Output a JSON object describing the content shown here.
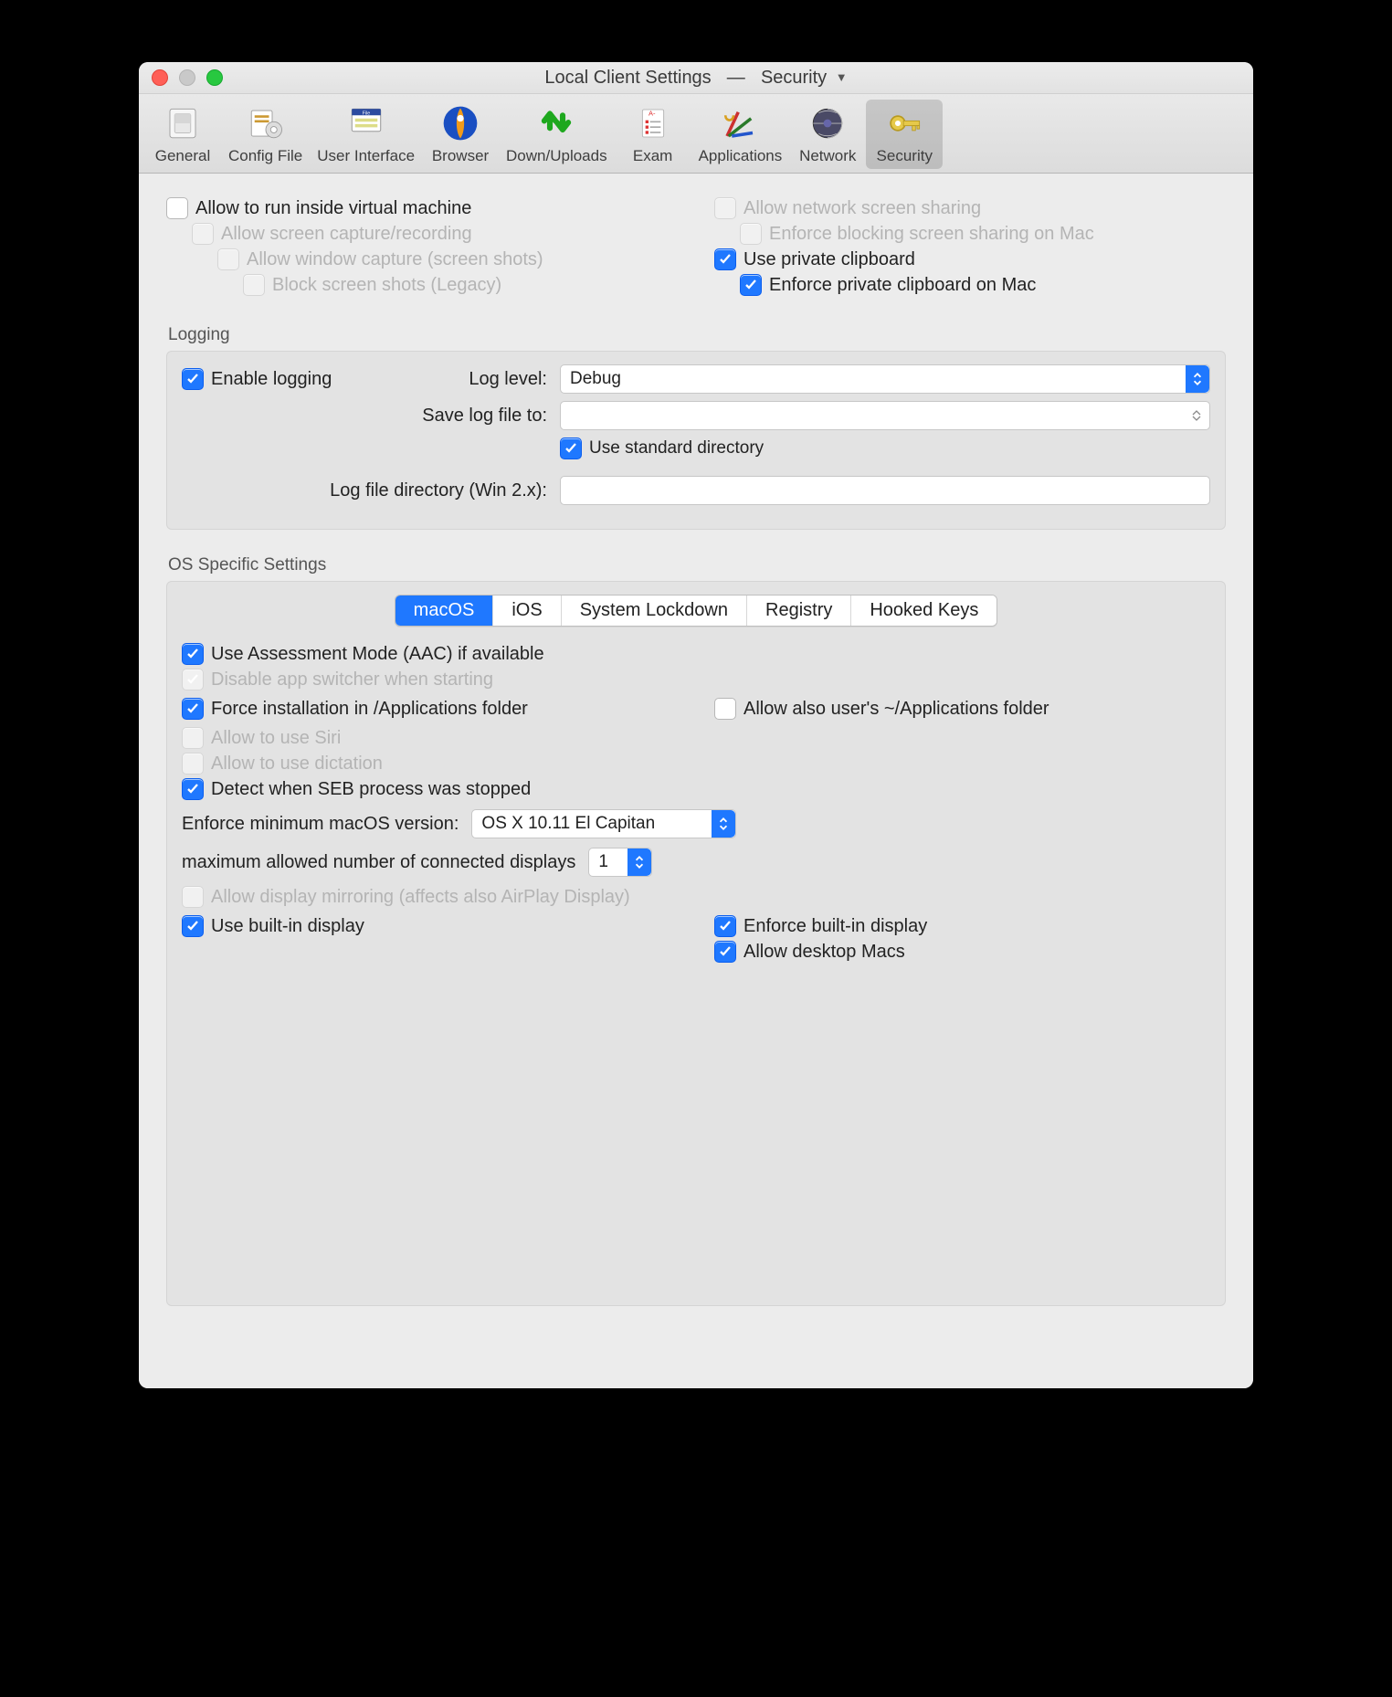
{
  "window": {
    "title_left": "Local Client Settings",
    "title_right": "Security"
  },
  "toolbar": [
    {
      "id": "general",
      "label": "General"
    },
    {
      "id": "config",
      "label": "Config File"
    },
    {
      "id": "ui",
      "label": "User Interface"
    },
    {
      "id": "browser",
      "label": "Browser"
    },
    {
      "id": "updown",
      "label": "Down/Uploads"
    },
    {
      "id": "exam",
      "label": "Exam"
    },
    {
      "id": "apps",
      "label": "Applications"
    },
    {
      "id": "network",
      "label": "Network"
    },
    {
      "id": "security",
      "label": "Security"
    }
  ],
  "top_left": {
    "allow_vm": "Allow to run inside virtual machine",
    "allow_capture": "Allow screen capture/recording",
    "allow_window_capture": "Allow window capture (screen shots)",
    "block_screenshots": "Block screen shots (Legacy)"
  },
  "top_right": {
    "allow_screenshare": "Allow network screen sharing",
    "enforce_block_share": "Enforce blocking screen sharing on Mac",
    "use_private_clip": "Use private clipboard",
    "enforce_private_clip": "Enforce private clipboard on Mac"
  },
  "logging": {
    "title": "Logging",
    "enable_logging": "Enable logging",
    "log_level_label": "Log level:",
    "log_level_value": "Debug",
    "save_to_label": "Save log file to:",
    "save_to_value": "",
    "use_std_dir": "Use standard directory",
    "log_dir_label": "Log file directory (Win 2.x):",
    "log_dir_value": ""
  },
  "os": {
    "title": "OS Specific Settings",
    "tabs": [
      "macOS",
      "iOS",
      "System Lockdown",
      "Registry",
      "Hooked Keys"
    ],
    "use_aac": "Use Assessment Mode (AAC) if available",
    "disable_app_switcher": "Disable app switcher when starting",
    "force_install": "Force installation in /Applications folder",
    "allow_user_apps": "Allow also user's ~/Applications folder",
    "allow_siri": "Allow to use Siri",
    "allow_dictation": "Allow to use dictation",
    "detect_stopped": "Detect when SEB process was stopped",
    "enforce_min_label": "Enforce minimum macOS version:",
    "enforce_min_value": "OS X 10.11 El Capitan",
    "max_displays_label": "maximum allowed number of connected displays",
    "max_displays_value": "1",
    "allow_mirroring": "Allow display mirroring (affects also AirPlay Display)",
    "use_builtin": "Use built-in display",
    "enforce_builtin": "Enforce built-in display",
    "allow_desktop_macs": "Allow desktop Macs"
  }
}
